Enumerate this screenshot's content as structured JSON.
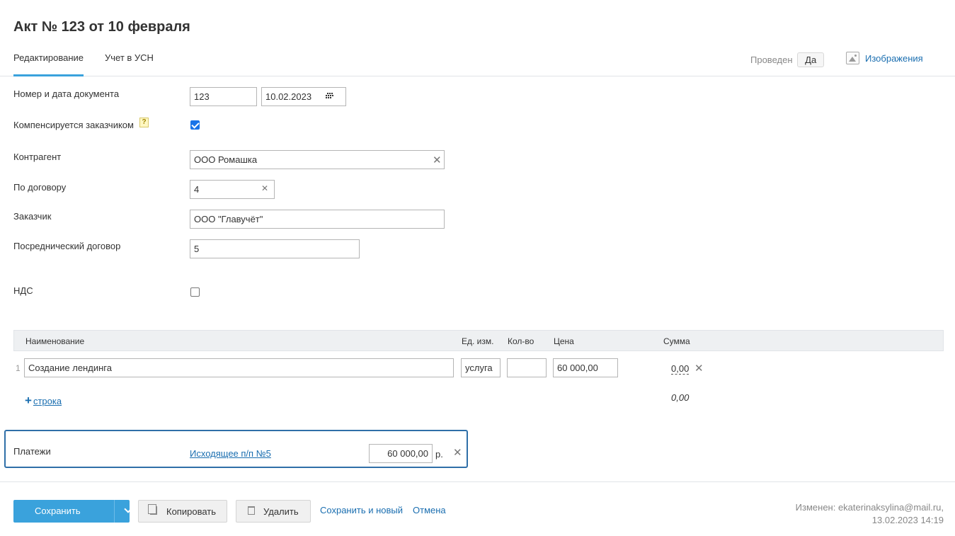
{
  "page": {
    "title": "Акт № 123 от 10 февраля"
  },
  "tabs": [
    {
      "label": "Редактирование",
      "active": true
    },
    {
      "label": "Учет в УСН",
      "active": false
    }
  ],
  "header": {
    "posted_label": "Проведен",
    "posted_value": "Да",
    "images_label": "Изображения"
  },
  "form": {
    "doc_number_label": "Номер и дата документа",
    "doc_number": "123",
    "doc_date": "10.02.2023",
    "compensated_label": "Компенсируется заказчиком",
    "compensated_help": "?",
    "compensated_checked": true,
    "counterparty_label": "Контрагент",
    "counterparty": "ООО Ромашка",
    "contract_label": "По договору",
    "contract": "4",
    "customer_label": "Заказчик",
    "customer": "ООО \"Главучёт\"",
    "agency_contract_label": "Посреднический договор",
    "agency_contract": "5",
    "vat_label": "НДС",
    "vat_checked": false
  },
  "table": {
    "headers": {
      "name": "Наименование",
      "unit": "Ед. изм.",
      "qty": "Кол-во",
      "price": "Цена",
      "sum": "Сумма"
    },
    "rows": [
      {
        "num": "1",
        "name": "Создание лендинга",
        "unit": "услуга",
        "qty": "",
        "price": "60 000,00",
        "sum": "0,00"
      }
    ],
    "add_row_label": "строка",
    "total": "0,00"
  },
  "payments": {
    "label": "Платежи",
    "link": "Исходящее п/п №5",
    "amount": "60 000,00",
    "unit": "р."
  },
  "footer": {
    "save_label": "Сохранить",
    "copy_label": "Копировать",
    "delete_label": "Удалить",
    "save_new_label": "Сохранить и новый",
    "cancel_label": "Отмена",
    "modified_line1": "Изменен: ekaterinaksylina@mail.ru,",
    "modified_line2": "13.02.2023 14:19"
  },
  "colors": {
    "accent": "#3aa2dc",
    "link": "#1a6eb0",
    "focus_border": "#2f6fa8"
  }
}
